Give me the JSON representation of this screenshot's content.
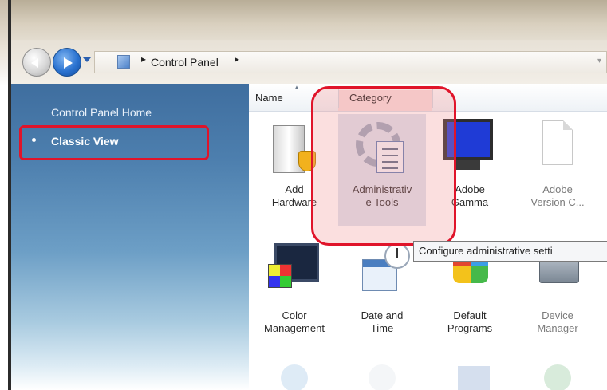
{
  "address_bar": {
    "path": "Control Panel",
    "separator": "▸",
    "dropdown_icon": "chevron-down-icon"
  },
  "sidebar": {
    "home_label": "Control Panel Home",
    "classic_view_label": "Classic View",
    "highlight_color": "#e0142a"
  },
  "columns": {
    "name": "Name",
    "category": "Category"
  },
  "items": [
    {
      "label_line1": "Add",
      "label_line2": "Hardware",
      "icon": "add-hardware-icon"
    },
    {
      "label_line1": "Administrativ",
      "label_line2": "e Tools",
      "icon": "administrative-tools-icon",
      "selected": true
    },
    {
      "label_line1": "Adobe",
      "label_line2": "Gamma",
      "icon": "adobe-gamma-icon"
    },
    {
      "label_line1": "Adobe",
      "label_line2": "Version C...",
      "icon": "adobe-version-cue-icon"
    },
    {
      "label_line1": "Color",
      "label_line2": "Management",
      "icon": "color-management-icon"
    },
    {
      "label_line1": "Date and",
      "label_line2": "Time",
      "icon": "date-and-time-icon"
    },
    {
      "label_line1": "Default",
      "label_line2": "Programs",
      "icon": "default-programs-icon"
    },
    {
      "label_line1": "Device",
      "label_line2": "Manager",
      "icon": "device-manager-icon"
    }
  ],
  "tooltip": "Configure administrative setti"
}
